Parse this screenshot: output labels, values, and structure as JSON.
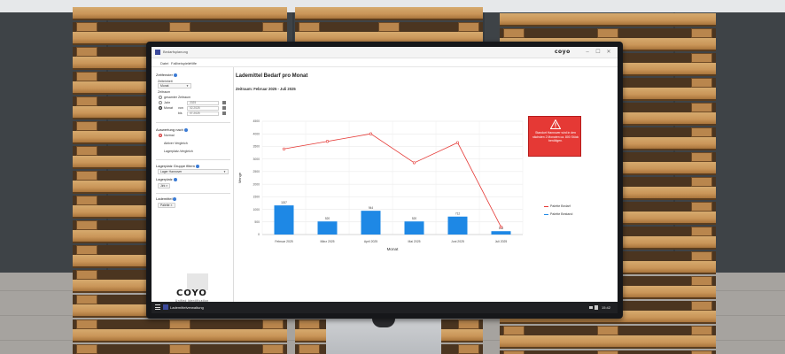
{
  "window": {
    "title": "Bedarfsplanung",
    "brand": "coyo",
    "minimize": "–",
    "maximize": "☐",
    "close": "✕"
  },
  "menu": [
    "Datei",
    "Fallbeispiele",
    "Hilfe"
  ],
  "sidebar": {
    "zeitfenster": {
      "heading": "Zeitfenster",
      "einheit_label": "Zeiteinheit",
      "einheit_value": "Monat",
      "zeitraum_label": "Zeitraum",
      "options": [
        "gesamter Zeitraum",
        "Jahr",
        "Monat"
      ],
      "jahr_value": "2025",
      "von_label": "von",
      "von_value": "02.2025",
      "bis_label": "bis",
      "bis_value": "07.2025"
    },
    "auswertung": {
      "heading": "Auswertung nach",
      "options": [
        "Normal",
        "Aktiver Vergleich",
        "Lagerplatz-Vergleich"
      ]
    },
    "gruppe": {
      "heading": "Lagerplatz Gruppe filtern",
      "value": "Lager Hannover"
    },
    "lagerplatz": {
      "heading": "Lagerplatz",
      "chip": "Jirk"
    },
    "lademittel": {
      "heading": "Lademittel",
      "chip": "Palette"
    },
    "logo": {
      "word": "COYO",
      "tagline": "Unified Identification"
    }
  },
  "main": {
    "title": "Lademittel Bedarf pro Monat",
    "subtitle": "Zeitraum: Februar 2025 - Juli 2025"
  },
  "alert": {
    "text": "Standort Hannover wird in den nächsten 2 Monaten ca. 800 Stück benötigen."
  },
  "chart_data": {
    "type": "bar",
    "categories": [
      "Februar 2025",
      "März 2025",
      "April 2025",
      "Mai 2025",
      "Juni 2025",
      "Juli 2025"
    ],
    "series": [
      {
        "name": "Palette Bestand",
        "type": "bar",
        "values": [
          1157,
          520,
          944,
          520,
          712,
          133
        ],
        "labels": [
          "1157",
          "520",
          "944",
          "520",
          "712",
          "133"
        ],
        "color": "#1e88e5"
      },
      {
        "name": "Palette Bedarf",
        "type": "line",
        "values": [
          3400,
          3700,
          4000,
          2850,
          3650,
          300
        ],
        "color": "#e53935"
      }
    ],
    "xlabel": "Monat",
    "ylabel": "Menge",
    "ylim": [
      0,
      4500
    ],
    "yticks": [
      0,
      500,
      1000,
      1500,
      2000,
      2500,
      3000,
      3500,
      4000,
      4500
    ],
    "grid": true,
    "legend": "right"
  },
  "taskbar": {
    "app_label": "Lademittelverwaltung",
    "clock": "15:42"
  },
  "colors": {
    "accent": "#1e88e5",
    "alert": "#e53935",
    "info": "#3a7bd5"
  }
}
